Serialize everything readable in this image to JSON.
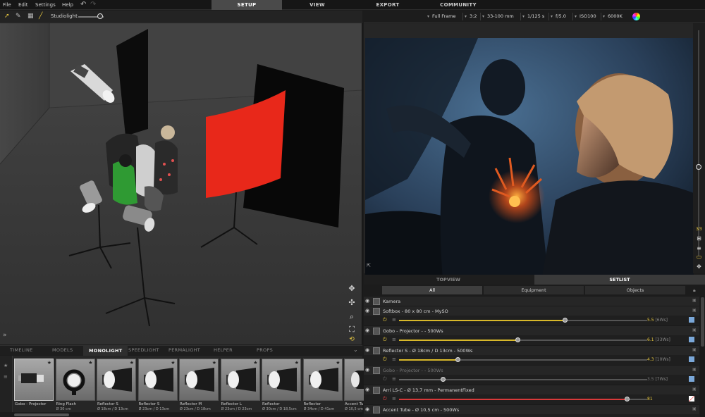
{
  "menubar": {
    "items": [
      "File",
      "Edit",
      "Settings",
      "Help"
    ],
    "undo_icon": "undo-icon",
    "redo_icon": "redo-icon"
  },
  "main_tabs": [
    {
      "label": "SETUP",
      "active": true
    },
    {
      "label": "VIEW",
      "active": false
    },
    {
      "label": "EXPORT",
      "active": false
    },
    {
      "label": "COMMUNITY",
      "active": false
    }
  ],
  "viewport_toolbar": {
    "tools": [
      "select-arrow-icon",
      "measure-icon",
      "grid-icon",
      "line-icon"
    ],
    "studiolight_label": "Studiolight",
    "studiolight_level": 0.85
  },
  "camera_bar": {
    "sensor": "Full Frame",
    "aspect": "3:2",
    "lens": "33-100 mm",
    "shutter": "1/125 s",
    "aperture": "f/5.0",
    "iso": "ISO100",
    "white_balance": "6000K"
  },
  "panel_tabs": [
    {
      "label": "TOPVIEW",
      "active": false
    },
    {
      "label": "SETLIST",
      "active": true
    }
  ],
  "filter_tabs": [
    {
      "label": "All",
      "active": true
    },
    {
      "label": "Equipment",
      "active": false
    },
    {
      "label": "Objects",
      "active": false
    }
  ],
  "setlist": {
    "camera_label": "Kamera",
    "rows": [
      {
        "name": "Softbox - 80 x 80 cm - MySO",
        "level": 0.67,
        "value": "5.5",
        "ws": "[6Ws]",
        "on": true,
        "color": "#7aa7d8",
        "bar": "#d8b82a",
        "active": true
      },
      {
        "name": "Gobo - Projector - - 500Ws",
        "level": 0.48,
        "value": "6.1",
        "ws": "[33Ws]",
        "on": true,
        "color": "#7aa7d8",
        "bar": "#d8b82a",
        "active": true
      },
      {
        "name": "Reflector S - Ø 18cm / D 13cm - 500Ws",
        "level": 0.24,
        "value": "4.3",
        "ws": "[10Ws]",
        "on": true,
        "color": "#7aa7d8",
        "bar": "#d8b82a",
        "active": true
      },
      {
        "name": "Gobo - Projector - - 500Ws",
        "level": 0.18,
        "value": "3.5",
        "ws": "[7Ws]",
        "on": false,
        "color": "#7aa7d8",
        "bar": "#666666",
        "active": false
      },
      {
        "name": "Arri LS-C - Ø 13,7 mm - PermanentFixed",
        "level": 0.92,
        "value": "81",
        "ws": "",
        "on": true,
        "color": "#ffffff",
        "bar": "#d83a3a",
        "active": true
      }
    ],
    "last_row": "Accent Tube - Ø 10,5 cm - 500Ws"
  },
  "library": {
    "tabs": [
      {
        "label": "TIMELINE",
        "active": false
      },
      {
        "label": "MODELS",
        "active": false
      },
      {
        "label": "MONOLIGHT",
        "active": true
      },
      {
        "label": "SPEEDLIGHT",
        "active": false
      },
      {
        "label": "PERMALIGHT",
        "active": false
      },
      {
        "label": "HELPER",
        "active": false
      },
      {
        "label": "PROPS",
        "active": false
      }
    ],
    "items": [
      {
        "name": "Gobo - Projector",
        "sub": "",
        "icon": "gobo-projector-icon"
      },
      {
        "name": "Ring Flash",
        "sub": "Ø 30 cm",
        "icon": "ring-flash-icon"
      },
      {
        "name": "Reflector S",
        "sub": "Ø 18cm / D 13cm",
        "icon": "reflector-icon"
      },
      {
        "name": "Reflector S",
        "sub": "Ø 23cm / D 13cm",
        "icon": "reflector-icon"
      },
      {
        "name": "Reflector M",
        "sub": "Ø 23cm / D 18cm",
        "icon": "reflector-icon"
      },
      {
        "name": "Reflector L",
        "sub": "Ø 23cm / D 23cm",
        "icon": "reflector-icon"
      },
      {
        "name": "Reflector",
        "sub": "Ø 30cm / D 18,5cm",
        "icon": "reflector-icon"
      },
      {
        "name": "Reflector",
        "sub": "Ø 34cm / D 41cm",
        "icon": "reflector-icon"
      },
      {
        "name": "Accent Tu",
        "sub": "Ø 10,5 cm",
        "icon": "accent-tube-icon"
      }
    ]
  }
}
